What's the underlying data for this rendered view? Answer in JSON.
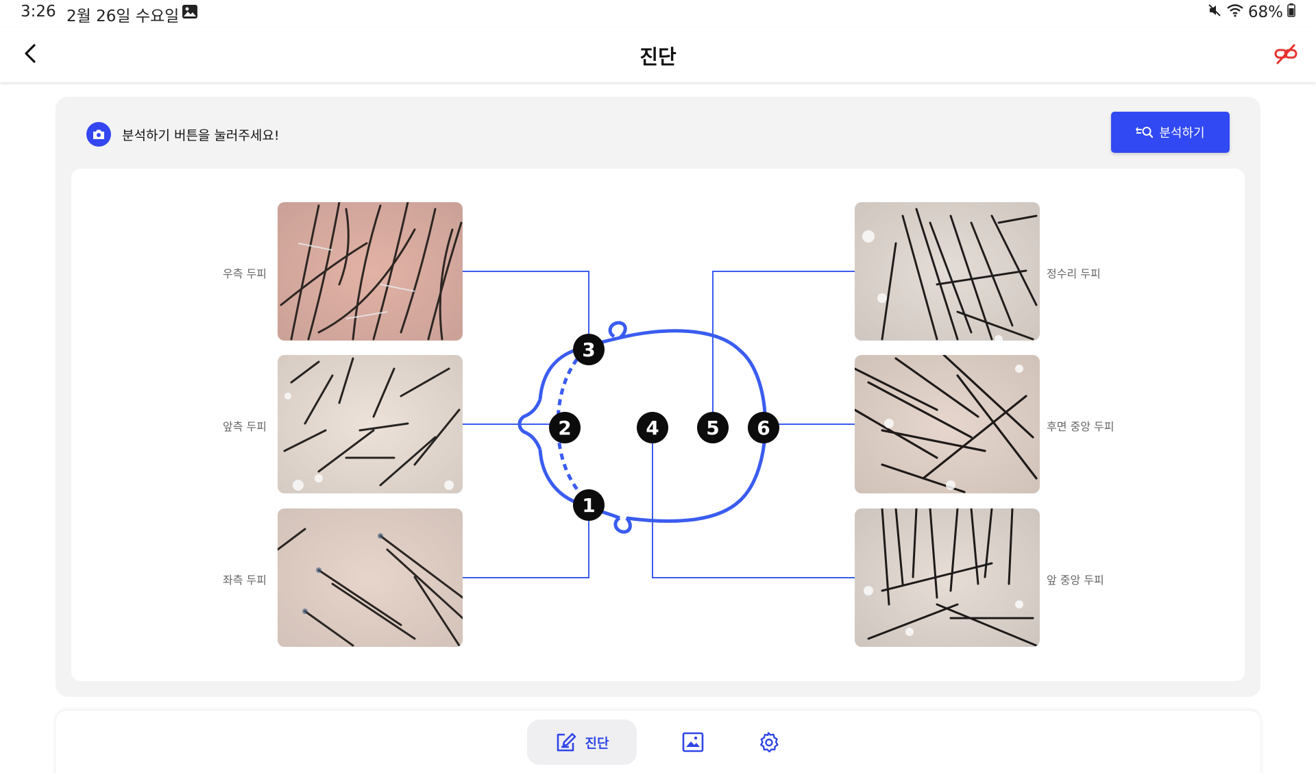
{
  "status_bar": {
    "time": "3:26",
    "date": "2월 26일 수요일",
    "battery": "68%",
    "icons": [
      "gallery-icon",
      "mute-icon",
      "wifi-icon",
      "battery-icon"
    ]
  },
  "header": {
    "title": "진단",
    "back_icon": "chevron-left-icon",
    "connection_icon": "link-broken-icon",
    "connection_color": "#e5322d"
  },
  "notice": {
    "text": "분석하기 버튼을 눌러주세요!",
    "icon": "camera-icon"
  },
  "analyze_button": {
    "label": "분석하기",
    "icon": "analysis-icon",
    "color": "#3149f2"
  },
  "zones": {
    "left": [
      {
        "label": "우측 두피",
        "marker": "3"
      },
      {
        "label": "앞측 두피",
        "marker": "2"
      },
      {
        "label": "좌측 두피",
        "marker": "1"
      }
    ],
    "right": [
      {
        "label": "정수리 두피",
        "marker": "5"
      },
      {
        "label": "후면 중앙 두피",
        "marker": "6"
      },
      {
        "label": "앞 중앙 두피",
        "marker": "4"
      }
    ]
  },
  "markers": [
    "1",
    "2",
    "3",
    "4",
    "5",
    "6"
  ],
  "diagram_color": "#3a5cf0",
  "bottom_nav": {
    "items": [
      {
        "label": "진단",
        "icon": "diagnosis-edit-icon",
        "active": true
      },
      {
        "label": "",
        "icon": "gallery-icon",
        "active": false
      },
      {
        "label": "",
        "icon": "settings-gear-icon",
        "active": false
      }
    ]
  }
}
